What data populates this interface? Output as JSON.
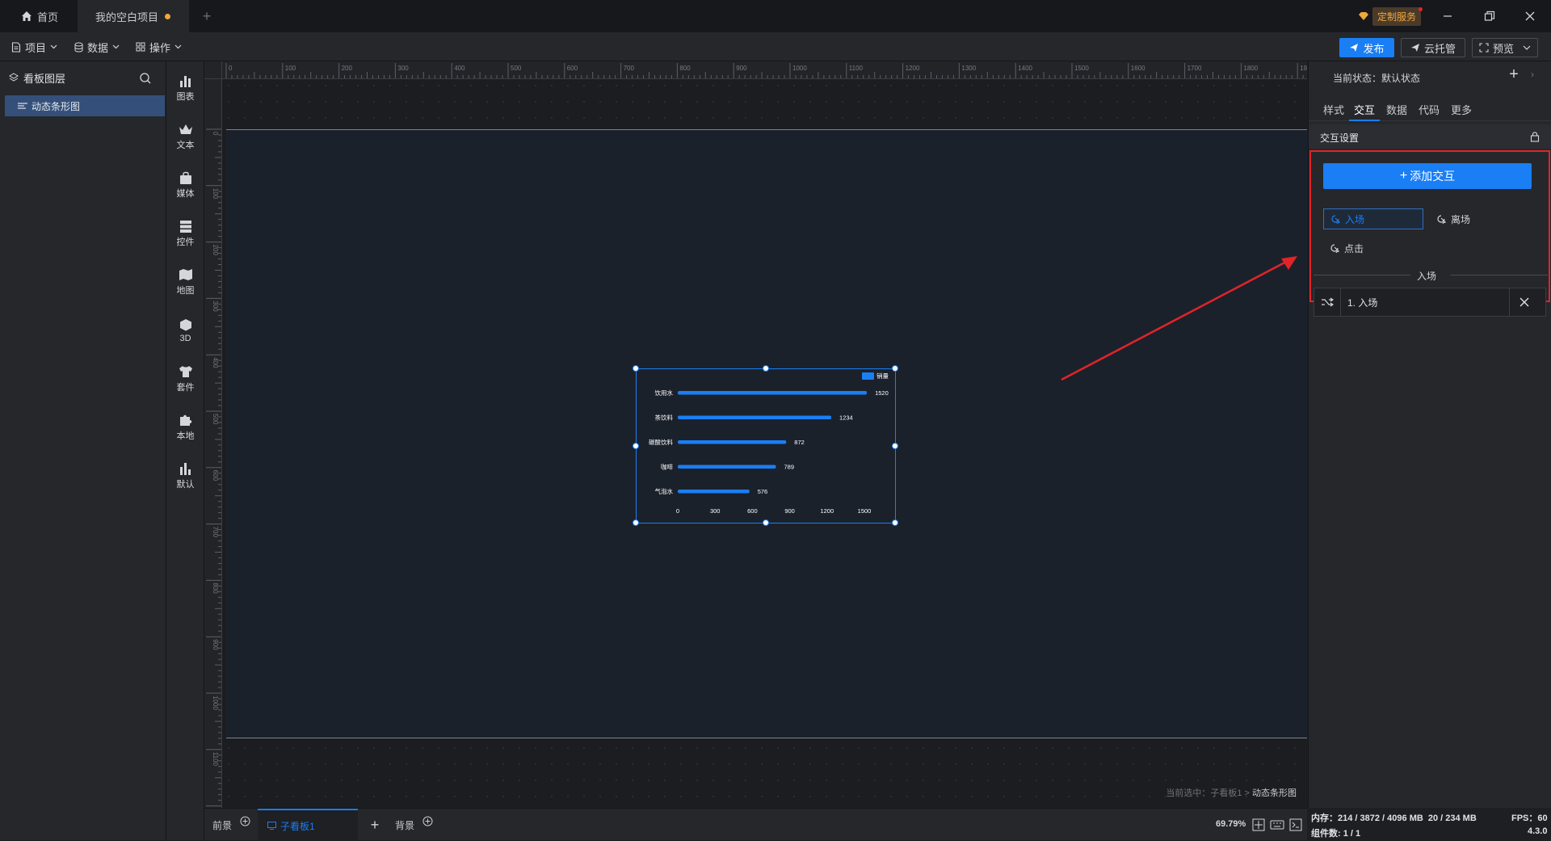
{
  "titlebar": {
    "home_tab": "首页",
    "project_tab": "我的空白项目",
    "custom_service": "定制服务"
  },
  "toolbar": {
    "menu_project": "项目",
    "menu_data": "数据",
    "menu_operate": "操作",
    "publish": "发布",
    "cloud_host": "云托管",
    "preview": "预览"
  },
  "layers": {
    "title": "看板图层",
    "items": [
      {
        "label": "动态条形图"
      }
    ]
  },
  "rail": {
    "items": [
      {
        "label": "图表",
        "icon": "bar-chart-icon"
      },
      {
        "label": "文本",
        "icon": "text-crown-icon"
      },
      {
        "label": "媒体",
        "icon": "media-bag-icon"
      },
      {
        "label": "控件",
        "icon": "control-stack-icon"
      },
      {
        "label": "地图",
        "icon": "map-icon"
      },
      {
        "label": "3D",
        "icon": "cube-icon"
      },
      {
        "label": "套件",
        "icon": "shirt-icon"
      },
      {
        "label": "本地",
        "icon": "puzzle-icon"
      },
      {
        "label": "默认",
        "icon": "default-chart-icon"
      }
    ]
  },
  "rulers": {
    "top_ticks": [
      "0",
      "100",
      "200",
      "300",
      "400",
      "500",
      "600",
      "700",
      "800",
      "900",
      "1000",
      "1100",
      "1200",
      "1300",
      "1400",
      "1500",
      "1600",
      "1700",
      "1800",
      "1900"
    ],
    "left_ticks": [
      "0",
      "100",
      "200",
      "300",
      "400",
      "500",
      "600",
      "700",
      "800",
      "900",
      "1000",
      "1100",
      "1200"
    ]
  },
  "canvas": {
    "selection_path_prefix": "当前选中：子看板1 >",
    "selection_path_current": "动态条形图"
  },
  "bottombar": {
    "foreground": "前景",
    "sub_board": "子看板1",
    "background": "背景",
    "zoom": "69.79%"
  },
  "right_panel": {
    "current_state_label": "当前状态：",
    "current_state_value": "默认状态",
    "tabs": [
      "样式",
      "交互",
      "数据",
      "代码",
      "更多"
    ],
    "active_tab": "交互",
    "section_title": "交互设置",
    "add_button": "添加交互",
    "triggers": [
      {
        "label": "入场",
        "selected": true
      },
      {
        "label": "离场",
        "selected": false
      },
      {
        "label": "点击",
        "selected": false
      }
    ],
    "divider_label": "入场",
    "interaction_item": "1. 入场"
  },
  "status": {
    "memory_label": "内存：",
    "memory_value": "214 / 3872 / 4096 MB",
    "memory_value2": "20 / 234 MB",
    "fps": "FPS：",
    "fps_value": "60",
    "components": "组件数: 1 / 1",
    "version": "4.3.0"
  },
  "colors": {
    "accent": "#1a7ef5",
    "bar": "#1a7ef5",
    "annotation_red": "#e0242a"
  },
  "chart_data": {
    "type": "bar",
    "orientation": "horizontal",
    "categories": [
      "饮用水",
      "茶饮料",
      "碳酸饮料",
      "咖啡",
      "气泡水"
    ],
    "series": [
      {
        "name": "销量",
        "values": [
          1520,
          1234,
          872,
          789,
          576
        ]
      }
    ],
    "x_ticks": [
      "0",
      "300",
      "600",
      "900",
      "1200",
      "1500"
    ],
    "xlim": [
      0,
      1500
    ],
    "legend": "top-right",
    "grid": false
  }
}
